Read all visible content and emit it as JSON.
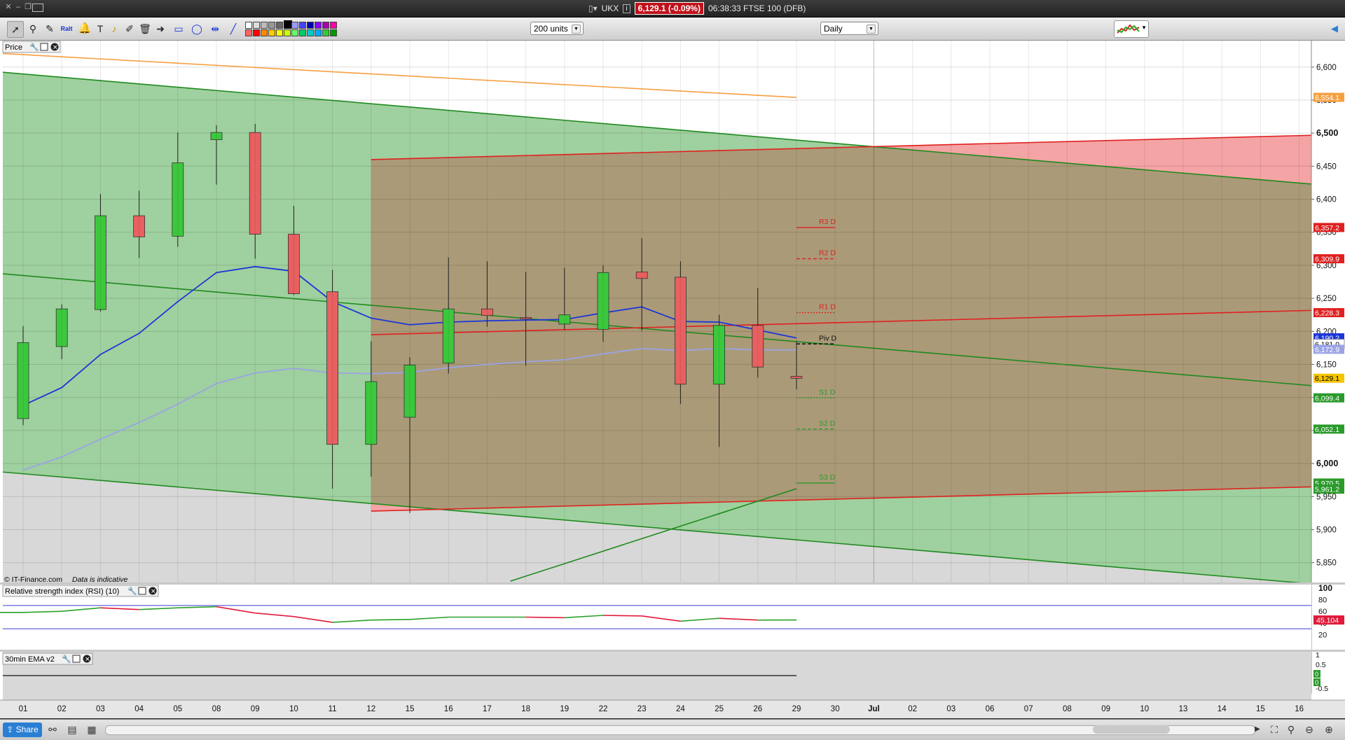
{
  "titlebar": {
    "symbol": "UKX",
    "price_badge": "6,129.1 (-0.09%)",
    "time_instrument": "06:38:33 FTSE 100 (DFB)"
  },
  "toolbar": {
    "units_select": "200 units",
    "period_select": "Daily"
  },
  "panels": {
    "price_label": "Price",
    "rsi_label": "Relative strength index (RSI) (10)",
    "ema_label": "30min EMA v2",
    "copyright": "© IT-Finance.com",
    "disclaimer": "Data is indicative"
  },
  "colors": {
    "bull": "#3cc83c",
    "bear": "#e86060",
    "pivot": "#111111",
    "resistance": "#e02020",
    "support": "#2a9a2a",
    "ma_fast": "#1a36d9",
    "ma_slow": "#9aa4e6",
    "ma_long": "#f5a040"
  },
  "chart_data": {
    "type": "candlestick",
    "x_labels": [
      "01",
      "02",
      "03",
      "04",
      "05",
      "08",
      "09",
      "10",
      "11",
      "12",
      "15",
      "16",
      "17",
      "18",
      "19",
      "22",
      "23",
      "24",
      "25",
      "26",
      "29",
      "30",
      "Jul",
      "02",
      "03",
      "06",
      "07",
      "08",
      "09",
      "10",
      "13",
      "14",
      "15",
      "16"
    ],
    "price_ticks": [
      "6,600",
      "6,550",
      "6,500",
      "6,450",
      "6,400",
      "6,350",
      "6,300",
      "6,250",
      "6,200",
      "6,150",
      "6,100",
      "6,050",
      "6,000",
      "5,950",
      "5,900",
      "5,850"
    ],
    "bold_ticks": [
      "6,500",
      "6,000"
    ],
    "ylim": [
      5820,
      6640
    ],
    "candles": [
      {
        "o": 6068,
        "h": 6208,
        "l": 6058,
        "c": 6183
      },
      {
        "o": 6177,
        "h": 6241,
        "l": 6158,
        "c": 6234
      },
      {
        "o": 6233,
        "h": 6408,
        "l": 6230,
        "c": 6375
      },
      {
        "o": 6375,
        "h": 6413,
        "l": 6311,
        "c": 6343
      },
      {
        "o": 6344,
        "h": 6501,
        "l": 6328,
        "c": 6455
      },
      {
        "o": 6490,
        "h": 6512,
        "l": 6422,
        "c": 6501
      },
      {
        "o": 6501,
        "h": 6514,
        "l": 6310,
        "c": 6347
      },
      {
        "o": 6347,
        "h": 6390,
        "l": 6255,
        "c": 6257
      },
      {
        "o": 6260,
        "h": 6293,
        "l": 5962,
        "c": 6029
      },
      {
        "o": 6029,
        "h": 6185,
        "l": 5980,
        "c": 6124
      },
      {
        "o": 6070,
        "h": 6161,
        "l": 5925,
        "c": 6149
      },
      {
        "o": 6152,
        "h": 6312,
        "l": 6136,
        "c": 6234
      },
      {
        "o": 6234,
        "h": 6306,
        "l": 6207,
        "c": 6224
      },
      {
        "o": 6221,
        "h": 6290,
        "l": 6148,
        "c": 6220
      },
      {
        "o": 6211,
        "h": 6296,
        "l": 6203,
        "c": 6225
      },
      {
        "o": 6203,
        "h": 6300,
        "l": 6184,
        "c": 6289
      },
      {
        "o": 6290,
        "h": 6341,
        "l": 6201,
        "c": 6280
      },
      {
        "o": 6282,
        "h": 6306,
        "l": 6090,
        "c": 6120
      },
      {
        "o": 6120,
        "h": 6225,
        "l": 6025,
        "c": 6209
      },
      {
        "o": 6209,
        "h": 6266,
        "l": 6130,
        "c": 6146
      },
      {
        "o": 6132,
        "h": 6185,
        "l": 6112,
        "c": 6129
      }
    ],
    "ma_fast": [
      6088,
      6115,
      6165,
      6197,
      6245,
      6289,
      6298,
      6291,
      6245,
      6220,
      6210,
      6214,
      6216,
      6217,
      6218,
      6228,
      6237,
      6215,
      6214,
      6202,
      6190
    ],
    "ma_slow": [
      5990,
      6010,
      6037,
      6062,
      6090,
      6121,
      6137,
      6144,
      6137,
      6136,
      6138,
      6145,
      6150,
      6154,
      6157,
      6166,
      6174,
      6171,
      6174,
      6172,
      6172
    ],
    "ma_long": {
      "from": [
        -1,
        6622
      ],
      "to": [
        20,
        6554
      ]
    },
    "pivots": [
      {
        "label": "R3 D",
        "value": 6357.2,
        "style": "solid",
        "color": "#e02020"
      },
      {
        "label": "R2 D",
        "value": 6309.9,
        "style": "dashed",
        "color": "#e02020"
      },
      {
        "label": "R1 D",
        "value": 6228.3,
        "style": "dotted",
        "color": "#e02020"
      },
      {
        "label": "Piv D",
        "value": 6181.0,
        "style": "dashed",
        "color": "#111111"
      },
      {
        "label": "S1 D",
        "value": 6099.4,
        "style": "dotted",
        "color": "#2a9a2a"
      },
      {
        "label": "S2 D",
        "value": 6052.1,
        "style": "dashed",
        "color": "#2a9a2a"
      },
      {
        "label": "S3 D",
        "value": 5970.5,
        "style": "solid",
        "color": "#2a9a2a"
      }
    ],
    "price_tags": [
      {
        "text": "6,554.1",
        "value": 6554.1,
        "bg": "#f5a040",
        "fg": "#ffffff"
      },
      {
        "text": "6,357.2",
        "value": 6357.2,
        "bg": "#e02020",
        "fg": "#ffffff"
      },
      {
        "text": "6,309.9",
        "value": 6309.9,
        "bg": "#e02020",
        "fg": "#ffffff"
      },
      {
        "text": "6,228.3",
        "value": 6228.3,
        "bg": "#e02020",
        "fg": "#ffffff"
      },
      {
        "text": "6,190.2",
        "value": 6190.2,
        "bg": "#1a36d9",
        "fg": "#ffffff"
      },
      {
        "text": "6,181.0",
        "value": 6181.0,
        "bg": "#ffffff",
        "fg": "#000000"
      },
      {
        "text": "6,172.9",
        "value": 6172.9,
        "bg": "#9aa4e6",
        "fg": "#ffffff"
      },
      {
        "text": "6,129.1",
        "value": 6129.1,
        "bg": "#f5c400",
        "fg": "#000000"
      },
      {
        "text": "6,099.4",
        "value": 6099.4,
        "bg": "#2a9a2a",
        "fg": "#ffffff"
      },
      {
        "text": "6,052.1",
        "value": 6052.1,
        "bg": "#2a9a2a",
        "fg": "#ffffff"
      },
      {
        "text": "5,970.5",
        "value": 5970.5,
        "bg": "#2a9a2a",
        "fg": "#ffffff"
      },
      {
        "text": "5,961.2",
        "value": 5961.2,
        "bg": "#2a9a2a",
        "fg": "#ffffff"
      }
    ],
    "trend_lines": [
      {
        "name": "green-channel-top",
        "from": [
          -0.5,
          6592
        ],
        "to": [
          33.5,
          6422
        ],
        "color": "#1f8a1f"
      },
      {
        "name": "green-channel-mid",
        "from": [
          -0.5,
          6287
        ],
        "to": [
          33.5,
          6117
        ],
        "color": "#1f8a1f"
      },
      {
        "name": "green-channel-bottom",
        "from": [
          -0.5,
          5987
        ],
        "to": [
          33.5,
          5817
        ],
        "color": "#1f8a1f"
      },
      {
        "name": "red-channel-top",
        "from": [
          9,
          6460
        ],
        "to": [
          33.5,
          6497
        ],
        "color": "#e02020"
      },
      {
        "name": "red-channel-mid",
        "from": [
          9,
          6195
        ],
        "to": [
          33.5,
          6232
        ],
        "color": "#e02020"
      },
      {
        "name": "red-channel-bottom",
        "from": [
          9,
          5928
        ],
        "to": [
          33.5,
          5965
        ],
        "color": "#e02020"
      },
      {
        "name": "support-trend",
        "from": [
          12.6,
          5822
        ],
        "to": [
          20,
          5962
        ],
        "color": "#1f8a1f"
      }
    ],
    "rsi": {
      "ticks": [
        "100",
        "80",
        "60",
        "40",
        "20"
      ],
      "levels": [
        70,
        30
      ],
      "values": [
        58,
        60,
        66,
        63,
        66,
        68,
        57,
        51,
        41,
        45,
        46,
        50,
        50,
        50,
        49,
        53,
        52,
        43,
        48,
        45,
        45.104
      ],
      "tag": "45.104"
    },
    "ema": {
      "ticks": [
        "1",
        "0.5",
        "0",
        "-0.5"
      ],
      "tags": [
        "0",
        "0"
      ]
    }
  }
}
